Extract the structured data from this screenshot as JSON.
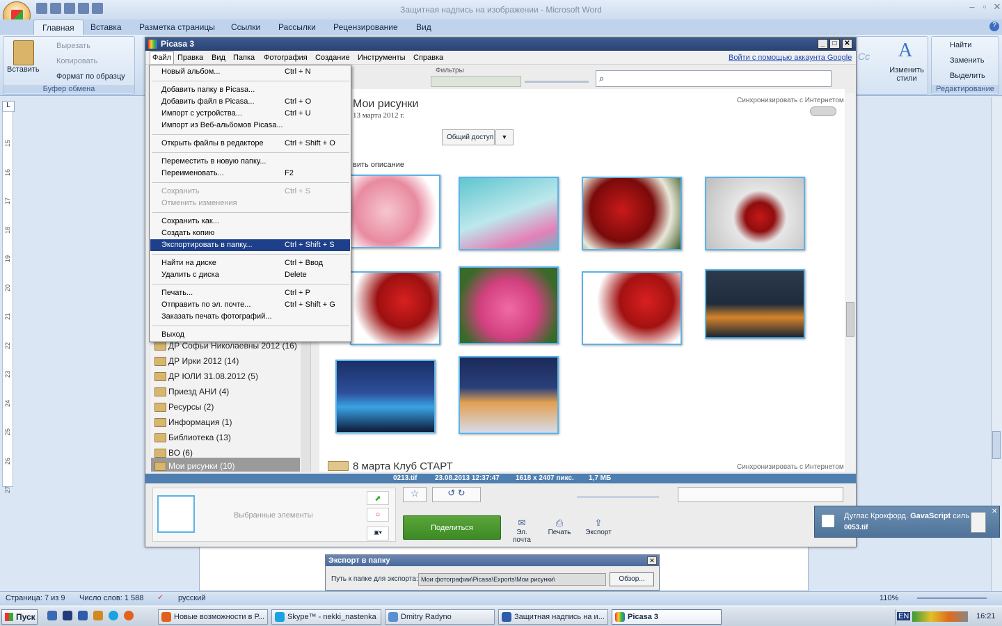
{
  "word": {
    "title": "Защитная надпись на изображении - Microsoft Word",
    "tabs": [
      "Главная",
      "Вставка",
      "Разметка страницы",
      "Ссылки",
      "Рассылки",
      "Рецензирование",
      "Вид"
    ],
    "clipboard": {
      "paste": "Вставить",
      "cut": "Вырезать",
      "copy": "Копировать",
      "format_painter": "Формат по образцу",
      "label": "Буфер обмена"
    },
    "styles": {
      "change": "Изменить стили",
      "cc": "Cc"
    },
    "editing": {
      "find": "Найти",
      "replace": "Заменить",
      "select": "Выделить",
      "label": "Редактирование"
    },
    "ruler_numbers": [
      "15",
      "16",
      "17",
      "18",
      "19",
      "20",
      "21",
      "22",
      "23",
      "24",
      "25",
      "26",
      "27"
    ],
    "status": {
      "page": "Страница: 7 из 9",
      "words": "Число слов: 1 588",
      "lang": "русский",
      "zoom": "110%"
    }
  },
  "picasa": {
    "title": "Picasa 3",
    "menu": [
      "Файл",
      "Правка",
      "Вид",
      "Папка",
      "Фотография",
      "Создание",
      "Инструменты",
      "Справка"
    ],
    "signin": "Войти с помощью аккаунта Google",
    "filters_label": "Фильтры",
    "album": {
      "title": "Мои рисунки",
      "date": "13 марта 2012 г.",
      "sync": "Синхронизировать с Интернетом",
      "share_btn": "Общий доступ",
      "desc": "вить описание"
    },
    "next_album": {
      "title": "8 марта Клуб СТАРТ",
      "sync": "Синхронизировать с Интернетом"
    },
    "folders": [
      "ДР Софьи Николаевны 2012 (16)",
      "ДР Ирки 2012 (14)",
      "ДР ЮЛИ 31.08.2012 (5)",
      "Приезд АНИ (4)",
      "Ресурсы (2)",
      "Информация (1)",
      "Библиотека (13)",
      "ВО (6)",
      "Мои рисунки (10)"
    ],
    "info": {
      "file": "0213.tif",
      "date": "23.08.2013 12:37:47",
      "size_px": "1618 x 2407 пикс.",
      "size_mb": "1,7 МБ"
    },
    "selected": "Выбранные элементы",
    "share": "Поделиться",
    "actions": [
      "Эл. почта",
      "Печать",
      "Экспорт"
    ]
  },
  "file_menu": [
    {
      "label": "Новый альбом...",
      "sc": "Ctrl + N"
    },
    {
      "sep": true
    },
    {
      "label": "Добавить папку в Picasa...",
      "sc": ""
    },
    {
      "label": "Добавить файл в Picasa...",
      "sc": "Ctrl + O"
    },
    {
      "label": "Импорт с устройства...",
      "sc": "Ctrl + U"
    },
    {
      "label": "Импорт из Веб-альбомов Picasa...",
      "sc": ""
    },
    {
      "sep": true
    },
    {
      "label": "Открыть файлы в редакторе",
      "sc": "Ctrl + Shift + O"
    },
    {
      "sep": true
    },
    {
      "label": "Переместить в новую папку...",
      "sc": ""
    },
    {
      "label": "Переименовать...",
      "sc": "F2"
    },
    {
      "sep": true
    },
    {
      "label": "Сохранить",
      "sc": "Ctrl + S",
      "disabled": true
    },
    {
      "label": "Отменить изменения",
      "sc": "",
      "disabled": true
    },
    {
      "sep": true
    },
    {
      "label": "Сохранить как...",
      "sc": ""
    },
    {
      "label": "Создать копию",
      "sc": ""
    },
    {
      "label": "Экспортировать в папку...",
      "sc": "Ctrl + Shift + S",
      "highlight": true
    },
    {
      "sep": true
    },
    {
      "label": "Найти на диске",
      "sc": "Ctrl + Ввод"
    },
    {
      "label": "Удалить с диска",
      "sc": "Delete"
    },
    {
      "sep": true
    },
    {
      "label": "Печать...",
      "sc": "Ctrl + P"
    },
    {
      "label": "Отправить по эл. почте...",
      "sc": "Ctrl + Shift + G"
    },
    {
      "label": "Заказать печать фотографий...",
      "sc": ""
    },
    {
      "sep": true
    },
    {
      "label": "Выход",
      "sc": ""
    }
  ],
  "export_dialog": {
    "title": "Экспорт в папку",
    "path_label": "Путь к папке для экспорта:",
    "path": "Мои фотографии\\Picasa\\Exports\\Мои рисунки\\",
    "browse": "Обзор..."
  },
  "notification": {
    "line1_prefix": "Дуглас Крокфорд.",
    "line1_bold": "GavaScript",
    "line1_suffix": "силь",
    "line2": "0053.tif"
  },
  "taskbar": {
    "start": "Пуск",
    "windows": [
      "Новые возможности в Р...",
      "Skype™ - nekki_nastenka",
      "Dmitry Radyno",
      "Защитная надпись на и...",
      "Picasa 3"
    ],
    "lang": "EN",
    "time": "16:21"
  }
}
